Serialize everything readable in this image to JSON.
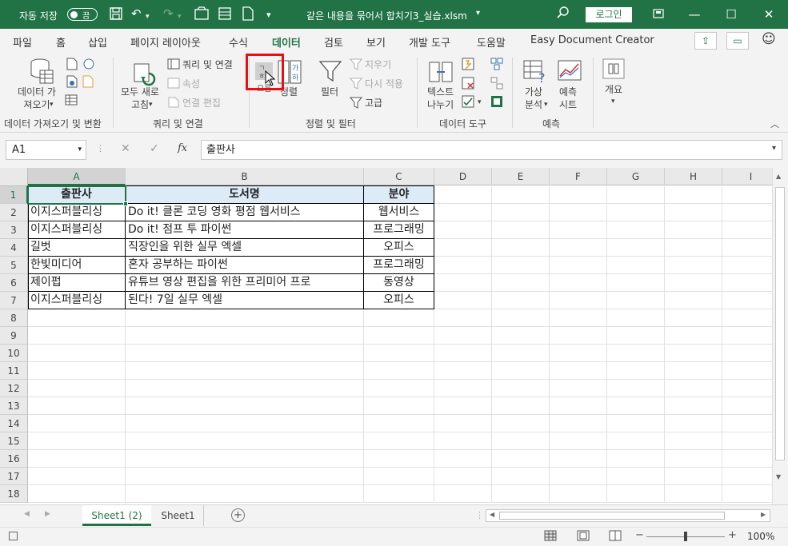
{
  "titlebar": {
    "autosave_label": "자동 저장",
    "autosave_state": "끔",
    "doc_title": "같은 내용을 묶어서 합치기3_실습.xlsm",
    "title_dropdown": "▾",
    "login_label": "로그인"
  },
  "menu": {
    "items": [
      "파일",
      "홈",
      "삽입",
      "페이지 레이아웃",
      "수식",
      "데이터",
      "검토",
      "보기",
      "개발 도구",
      "도움말",
      "Easy Document Creator"
    ],
    "active": "데이터"
  },
  "ribbon": {
    "get_data": "데이터 가\n져오기",
    "refresh_all": "모두 새로\n고침",
    "queries_connections": "쿼리 및 연결",
    "properties": "속성",
    "edit_links": "연결 편집",
    "sort_asc_label": "오름",
    "sort_label": "정렬",
    "filter": "필터",
    "clear": "지우기",
    "reapply": "다시 적용",
    "advanced": "고급",
    "text_to_columns": "텍스트\n나누기",
    "what_if": "가상\n분석",
    "forecast_sheet": "예측\n시트",
    "outline": "개요",
    "groups": {
      "get_transform": "데이터 가져오기 및 변환",
      "queries": "쿼리 및 연결",
      "sort_filter": "정렬 및 필터",
      "data_tools": "데이터 도구",
      "forecast": "예측"
    }
  },
  "formula_bar": {
    "name_box": "A1",
    "fx": "fx",
    "content": "출판사"
  },
  "sheet": {
    "columns": [
      "A",
      "B",
      "C",
      "D",
      "E",
      "F",
      "G",
      "H",
      "I"
    ],
    "rows": [
      "1",
      "2",
      "3",
      "4",
      "5",
      "6",
      "7",
      "8",
      "9",
      "10",
      "11",
      "12",
      "13",
      "14",
      "15",
      "16",
      "17",
      "18"
    ],
    "header": [
      "출판사",
      "도서명",
      "분야"
    ],
    "data": [
      [
        "이지스퍼블리싱",
        "Do it! 클론 코딩 영화 평점 웹서비스",
        "웹서비스"
      ],
      [
        "이지스퍼블리싱",
        "Do it! 점프 투 파이썬",
        "프로그래밍"
      ],
      [
        "길벗",
        "직장인을 위한 실무 엑셀",
        "오피스"
      ],
      [
        "한빛미디어",
        "혼자 공부하는 파이썬",
        "프로그래밍"
      ],
      [
        "제이펍",
        "유튜브 영상 편집을 위한 프리미어 프로",
        "동영상"
      ],
      [
        "이지스퍼블리싱",
        "된다! 7일 실무 엑셀",
        "오피스"
      ]
    ]
  },
  "tabs": {
    "items": [
      "Sheet1 (2)",
      "Sheet1"
    ],
    "active": "Sheet1 (2)"
  },
  "status": {
    "zoom": "100%"
  },
  "colors": {
    "excel_green": "#217346",
    "header_fill": "#ddebf7",
    "highlight": "#e81010"
  }
}
